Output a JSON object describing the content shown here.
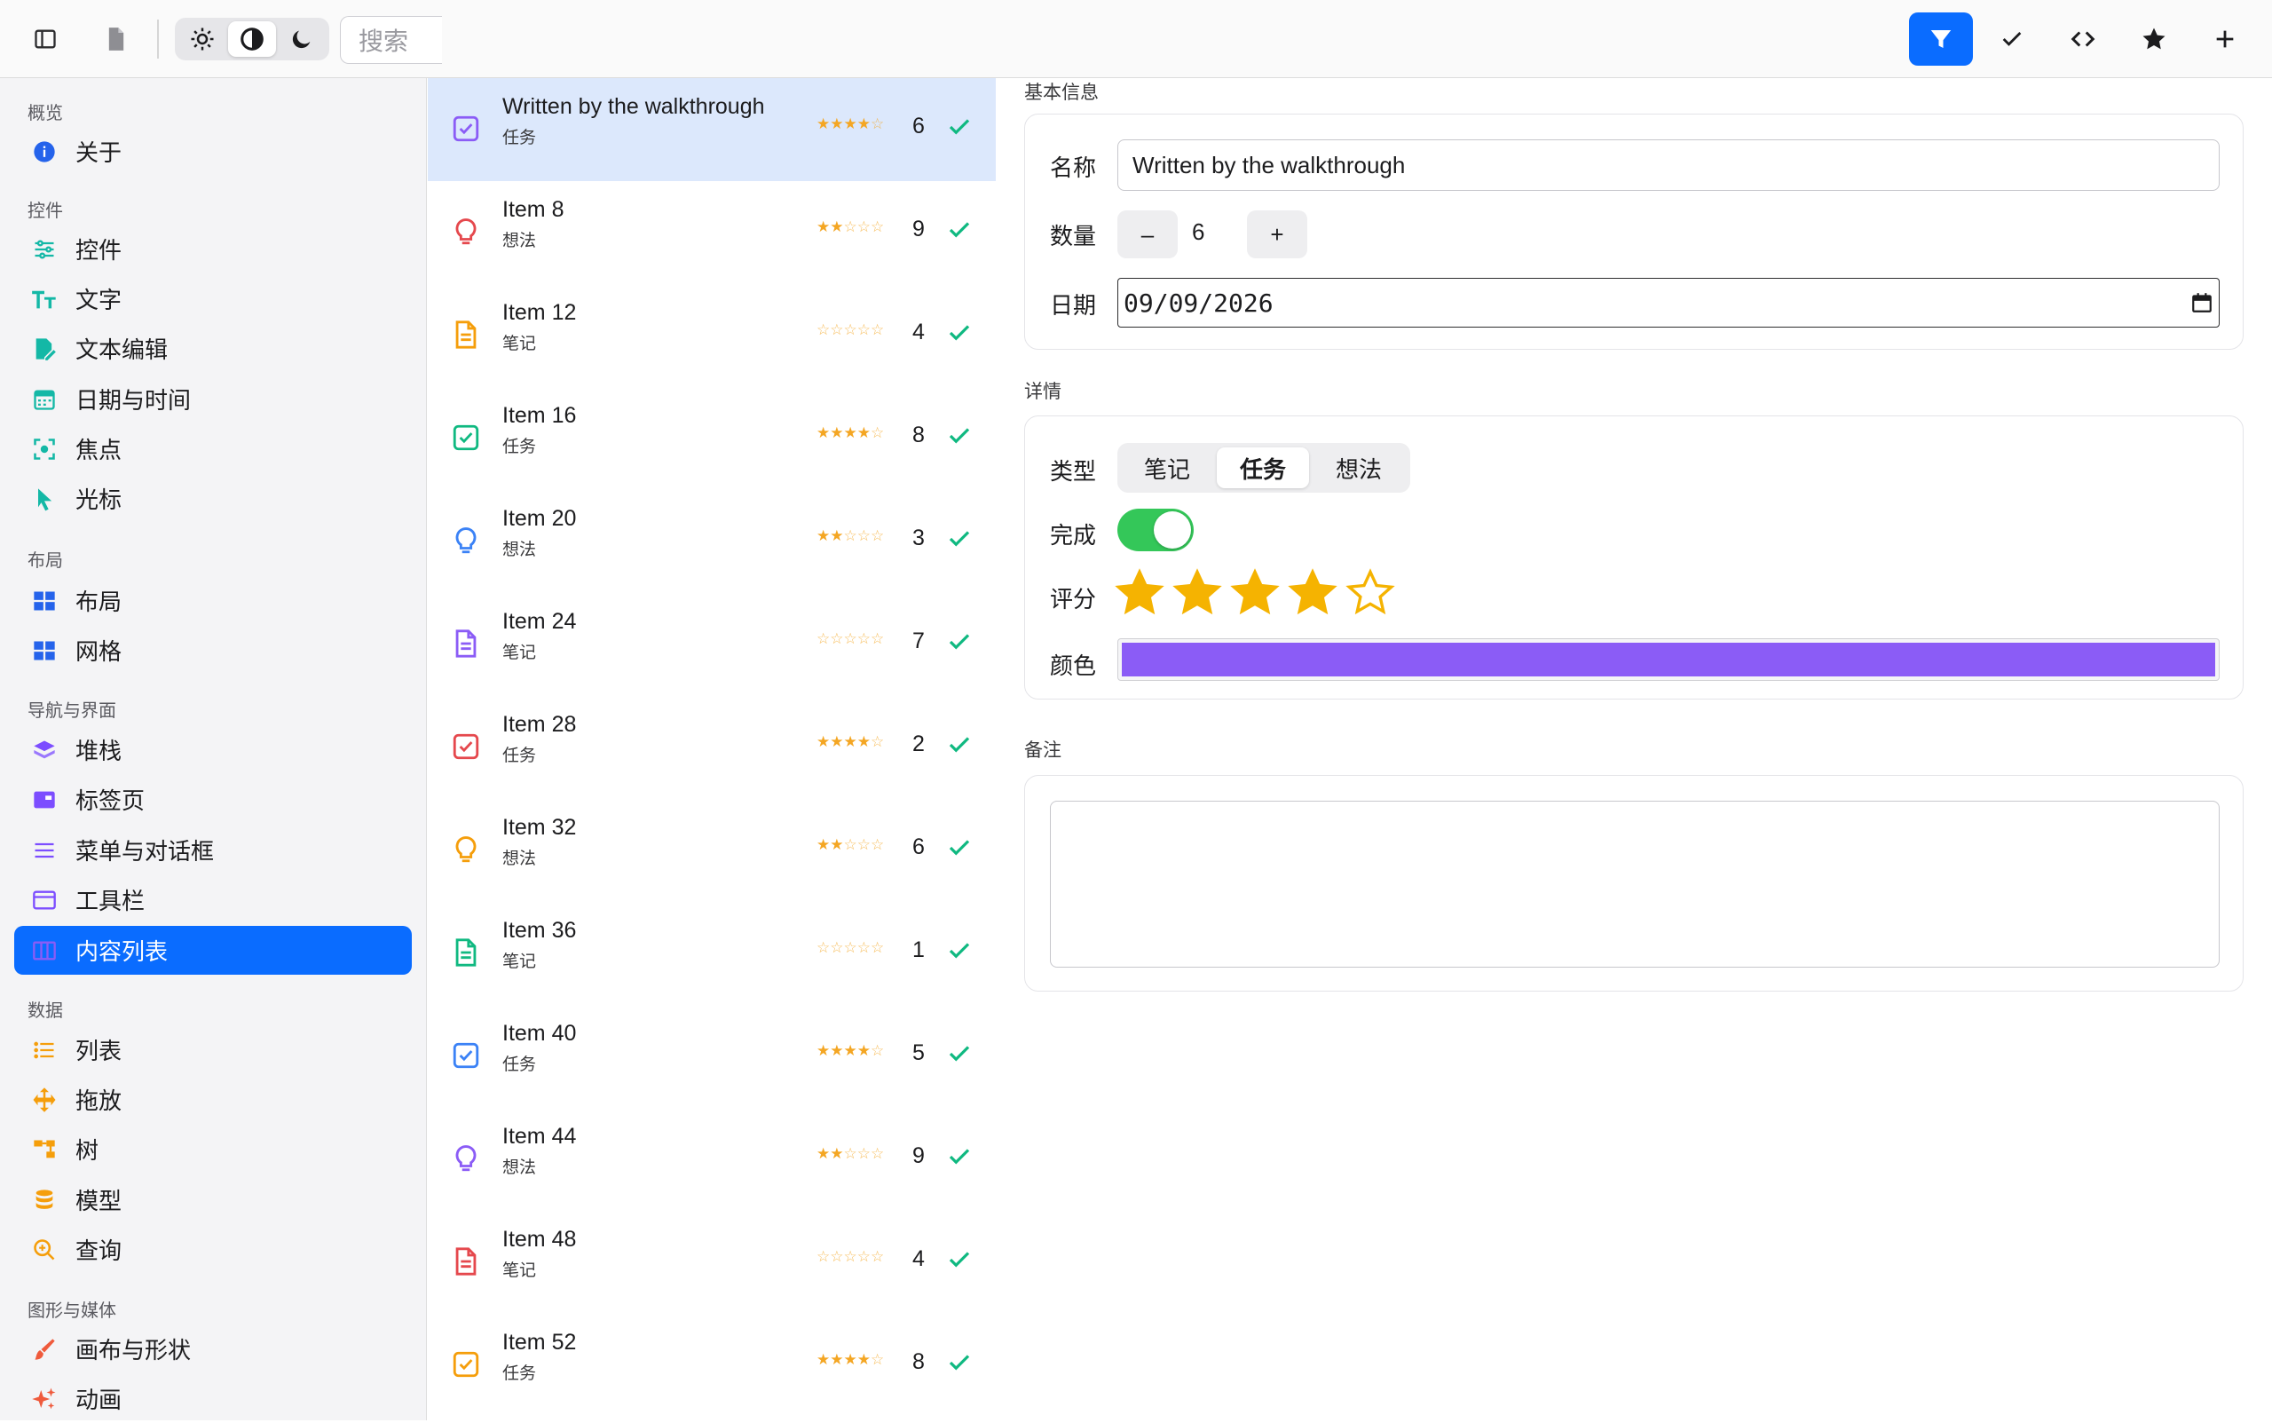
{
  "toolbar": {
    "search_placeholder": "搜索",
    "right_buttons": [
      "filter",
      "check",
      "code",
      "star",
      "add"
    ]
  },
  "sidebar": {
    "sections": [
      {
        "title": "概览",
        "items": [
          {
            "label": "关于",
            "icon": "info-icon"
          }
        ]
      },
      {
        "title": "控件",
        "items": [
          {
            "label": "控件",
            "icon": "sliders-icon"
          },
          {
            "label": "文字",
            "icon": "text-size-icon"
          },
          {
            "label": "文本编辑",
            "icon": "edit-document-icon"
          },
          {
            "label": "日期与时间",
            "icon": "calendar-icon"
          },
          {
            "label": "焦点",
            "icon": "focus-icon"
          },
          {
            "label": "光标",
            "icon": "cursor-icon"
          }
        ]
      },
      {
        "title": "布局",
        "items": [
          {
            "label": "布局",
            "icon": "layout-grid-icon"
          },
          {
            "label": "网格",
            "icon": "grid-icon"
          }
        ]
      },
      {
        "title": "导航与界面",
        "items": [
          {
            "label": "堆栈",
            "icon": "stack-icon"
          },
          {
            "label": "标签页",
            "icon": "tabs-icon"
          },
          {
            "label": "菜单与对话框",
            "icon": "menu-icon"
          },
          {
            "label": "工具栏",
            "icon": "toolbar-icon"
          },
          {
            "label": "内容列表",
            "icon": "columns-icon"
          }
        ]
      },
      {
        "title": "数据",
        "items": [
          {
            "label": "列表",
            "icon": "list-icon"
          },
          {
            "label": "拖放",
            "icon": "move-icon"
          },
          {
            "label": "树",
            "icon": "tree-icon"
          },
          {
            "label": "模型",
            "icon": "database-icon"
          },
          {
            "label": "查询",
            "icon": "search-zoom-icon"
          }
        ]
      },
      {
        "title": "图形与媒体",
        "items": [
          {
            "label": "画布与形状",
            "icon": "brush-icon"
          },
          {
            "label": "动画",
            "icon": "sparkle-icon"
          }
        ]
      }
    ],
    "selected": "内容列表"
  },
  "list": {
    "rows": [
      {
        "title": "Written by the walkthrough",
        "type": "任务",
        "rating": 4,
        "count": "6",
        "done": true,
        "kind": "task",
        "color": "#8b5cf6",
        "selected": true
      },
      {
        "title": "Item 8",
        "type": "想法",
        "rating": 2,
        "count": "9",
        "done": true,
        "kind": "idea",
        "color": "#e5484d"
      },
      {
        "title": "Item 12",
        "type": "笔记",
        "rating": 0,
        "count": "4",
        "done": true,
        "kind": "note",
        "color": "#f59e0b"
      },
      {
        "title": "Item 16",
        "type": "任务",
        "rating": 4,
        "count": "8",
        "done": true,
        "kind": "task",
        "color": "#10b981"
      },
      {
        "title": "Item 20",
        "type": "想法",
        "rating": 2,
        "count": "3",
        "done": true,
        "kind": "idea",
        "color": "#3b82f6"
      },
      {
        "title": "Item 24",
        "type": "笔记",
        "rating": 0,
        "count": "7",
        "done": true,
        "kind": "note",
        "color": "#8b5cf6"
      },
      {
        "title": "Item 28",
        "type": "任务",
        "rating": 4,
        "count": "2",
        "done": true,
        "kind": "task",
        "color": "#e5484d"
      },
      {
        "title": "Item 32",
        "type": "想法",
        "rating": 2,
        "count": "6",
        "done": true,
        "kind": "idea",
        "color": "#f59e0b"
      },
      {
        "title": "Item 36",
        "type": "笔记",
        "rating": 0,
        "count": "1",
        "done": true,
        "kind": "note",
        "color": "#10b981"
      },
      {
        "title": "Item 40",
        "type": "任务",
        "rating": 4,
        "count": "5",
        "done": true,
        "kind": "task",
        "color": "#3b82f6"
      },
      {
        "title": "Item 44",
        "type": "想法",
        "rating": 2,
        "count": "9",
        "done": true,
        "kind": "idea",
        "color": "#8b5cf6"
      },
      {
        "title": "Item 48",
        "type": "笔记",
        "rating": 0,
        "count": "4",
        "done": true,
        "kind": "note",
        "color": "#e5484d"
      },
      {
        "title": "Item 52",
        "type": "任务",
        "rating": 4,
        "count": "8",
        "done": true,
        "kind": "task",
        "color": "#f59e0b"
      }
    ]
  },
  "detail": {
    "basic_title": "基本信息",
    "name_label": "名称",
    "name_value": "Written by the walkthrough",
    "qty_label": "数量",
    "qty_minus": "–",
    "qty_value": "6",
    "qty_plus": "+",
    "date_label": "日期",
    "date_value": "09/09/2026",
    "details_title": "详情",
    "type_label": "类型",
    "type_options": [
      "笔记",
      "任务",
      "想法"
    ],
    "type_selected": "任务",
    "done_label": "完成",
    "done_value": true,
    "rating_label": "评分",
    "rating_value": 4,
    "rating_max": 5,
    "color_label": "颜色",
    "color_value": "#8b5cf6",
    "notes_title": "备注",
    "notes_value": ""
  },
  "colors": {
    "accent": "#0a6cff",
    "selected_row": "#dce8fc",
    "star": "#f4a623",
    "check": "#10b981",
    "toggle_on": "#34c759"
  }
}
